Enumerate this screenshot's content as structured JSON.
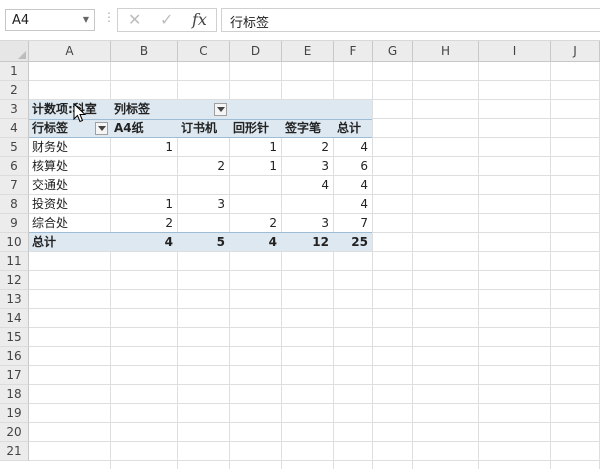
{
  "formula_bar": {
    "name_box": "A4",
    "cancel_icon": "✕",
    "enter_icon": "✓",
    "fx_label": "fx",
    "formula_value": "行标签"
  },
  "sheet": {
    "columns": [
      "A",
      "B",
      "C",
      "D",
      "E",
      "F",
      "G",
      "H",
      "I",
      "J"
    ],
    "rows": [
      "1",
      "2",
      "3",
      "4",
      "5",
      "6",
      "7",
      "8",
      "9",
      "10",
      "11",
      "12",
      "13",
      "14",
      "15",
      "16",
      "17",
      "18",
      "19",
      "20",
      "21"
    ]
  },
  "pivot": {
    "value_field": "计数项:科室",
    "col_labels_caption": "列标签",
    "row_labels_caption": "行标签",
    "col_headers": [
      "A4纸",
      "订书机",
      "回形针",
      "签字笔",
      "总计"
    ],
    "rows": [
      {
        "label": "财务处",
        "cells": [
          "1",
          "",
          "1",
          "2",
          "4"
        ]
      },
      {
        "label": "核算处",
        "cells": [
          "",
          "2",
          "1",
          "3",
          "6"
        ]
      },
      {
        "label": "交通处",
        "cells": [
          "",
          "",
          "",
          "4",
          "4"
        ]
      },
      {
        "label": "投资处",
        "cells": [
          "1",
          "3",
          "",
          "",
          "4"
        ]
      },
      {
        "label": "综合处",
        "cells": [
          "2",
          "",
          "2",
          "3",
          "7"
        ]
      }
    ],
    "total": {
      "label": "总计",
      "cells": [
        "4",
        "5",
        "4",
        "12",
        "25"
      ]
    }
  },
  "colors": {
    "pivot_header_fill": "#dde8f1",
    "pivot_rule": "#9dbcd6"
  }
}
